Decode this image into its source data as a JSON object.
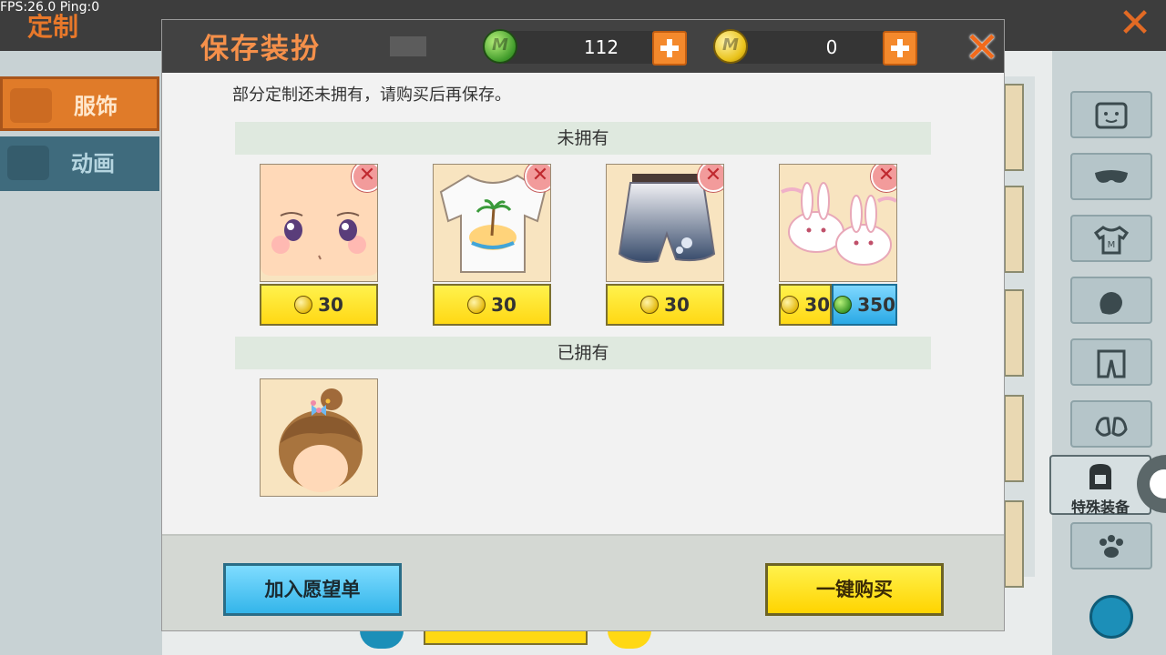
{
  "status": {
    "fps": "FPS:26.0",
    "ping": "Ping:0"
  },
  "background": {
    "title": "定制",
    "tabs": [
      {
        "label": "服饰",
        "active": true
      },
      {
        "label": "动画",
        "active": false
      }
    ],
    "special_equipment_label": "特殊装备",
    "category_icons": [
      "face-icon",
      "mask-icon",
      "shirt-icon",
      "glove-icon",
      "pants-icon",
      "shoes-icon",
      "backpack-icon",
      "paw-icon",
      "trash-icon"
    ]
  },
  "dialog": {
    "title": "保存装扮",
    "currency": {
      "gem": {
        "value": "112",
        "icon": "gem-icon",
        "color": "#3f9a2a"
      },
      "coin": {
        "value": "0",
        "icon": "coin-icon",
        "color": "#e9c21a"
      }
    },
    "close_symbol": "✕",
    "notice": "部分定制还未拥有，请购买后再保存。",
    "unowned_header": "未拥有",
    "owned_header": "已拥有",
    "unowned_items": [
      {
        "name": "face",
        "prices": [
          {
            "type": "coin",
            "value": "30"
          }
        ]
      },
      {
        "name": "tshirt",
        "prices": [
          {
            "type": "coin",
            "value": "30"
          }
        ]
      },
      {
        "name": "shorts",
        "prices": [
          {
            "type": "coin",
            "value": "30"
          }
        ]
      },
      {
        "name": "bunny-slippers",
        "prices": [
          {
            "type": "coin",
            "value": "30"
          },
          {
            "type": "gem",
            "value": "350"
          }
        ]
      }
    ],
    "owned_items": [
      {
        "name": "hair"
      }
    ],
    "buttons": {
      "wishlist": "加入愿望单",
      "buy_all": "一键购买"
    },
    "colors": {
      "title": "#f5904a",
      "coin_button": "#ffd814",
      "gem_button": "#33b5ea",
      "plus_button": "#f4892c",
      "close": "#f26a1b"
    }
  }
}
